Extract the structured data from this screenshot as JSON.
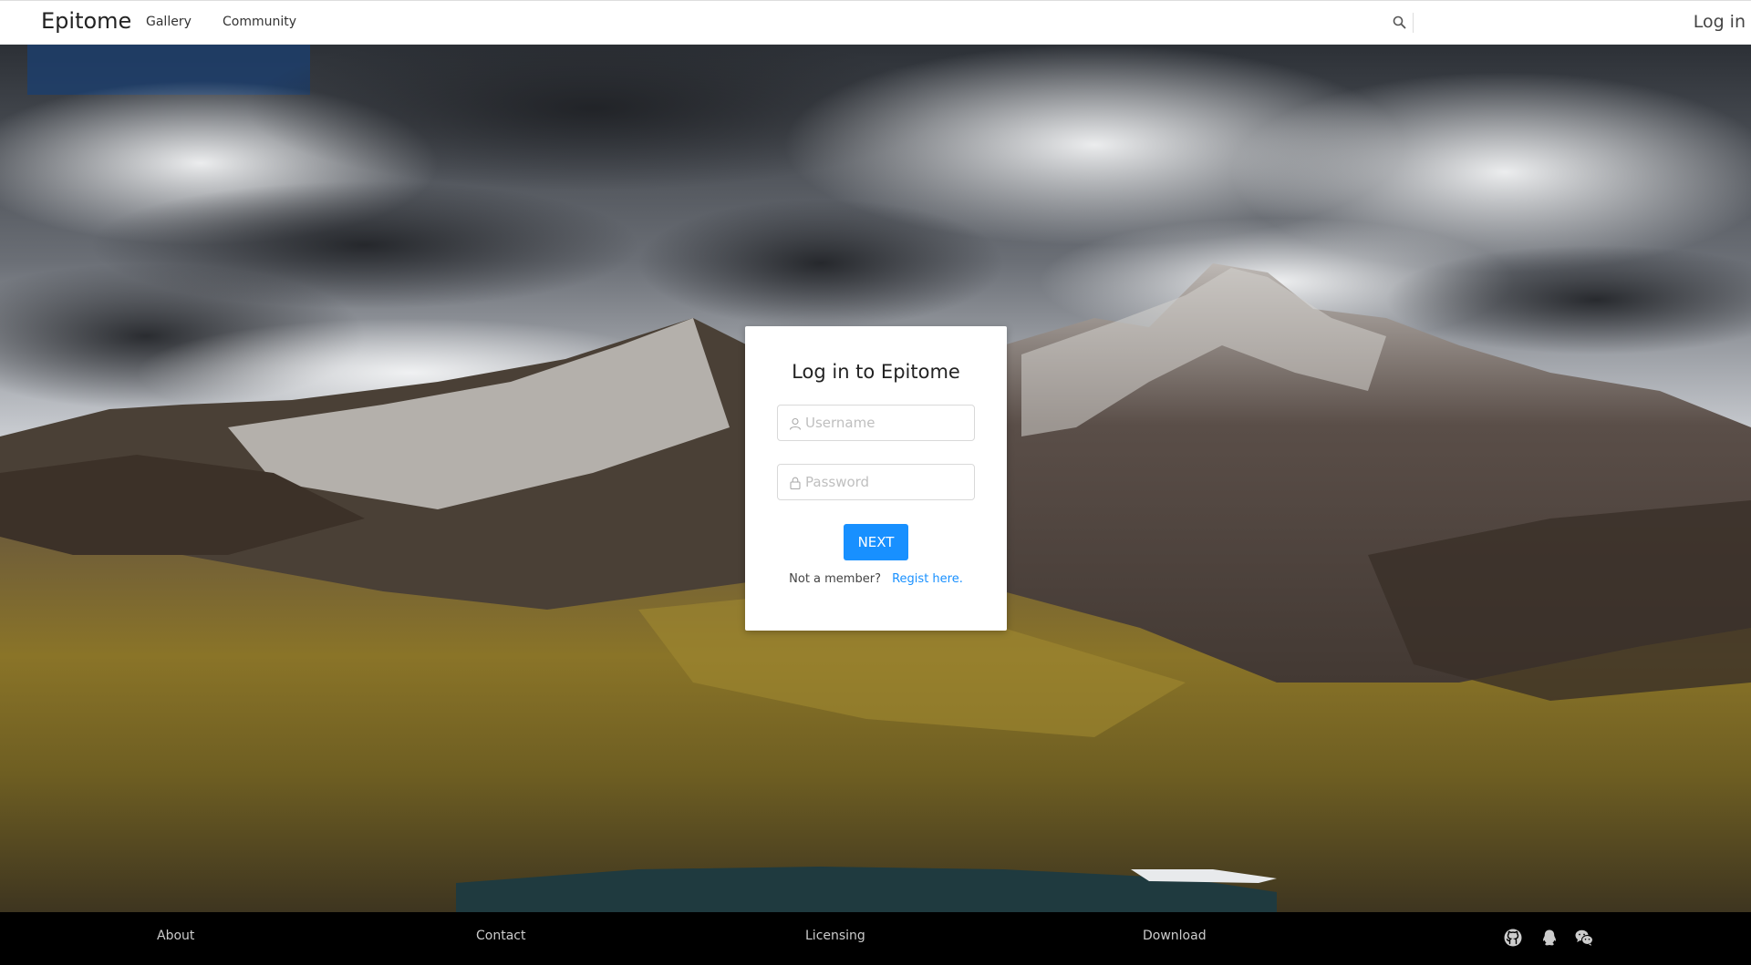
{
  "header": {
    "logo": "Epitome",
    "nav": {
      "gallery": "Gallery",
      "community": "Community"
    },
    "search_icon": "search-icon",
    "login": "Log in"
  },
  "hero": {
    "background": "mountain-landscape-photo",
    "colors": {
      "sky_dark": "#3a3c40",
      "cloud": "#e9ecef",
      "mountain_dark": "#3e3530",
      "grass": "#8a7428",
      "lake": "#1f3a3f"
    }
  },
  "login_card": {
    "title": "Log in to Epitome",
    "username_placeholder": "Username",
    "password_placeholder": "Password",
    "next_label": "NEXT",
    "member_text": "Not a member?",
    "regist_link": "Regist here.",
    "accent": "#1890ff"
  },
  "footer": {
    "links": {
      "about": "About",
      "contact": "Contact",
      "licensing": "Licensing",
      "download": "Download"
    },
    "icons": [
      "github-icon",
      "qq-icon",
      "wechat-icon"
    ]
  }
}
